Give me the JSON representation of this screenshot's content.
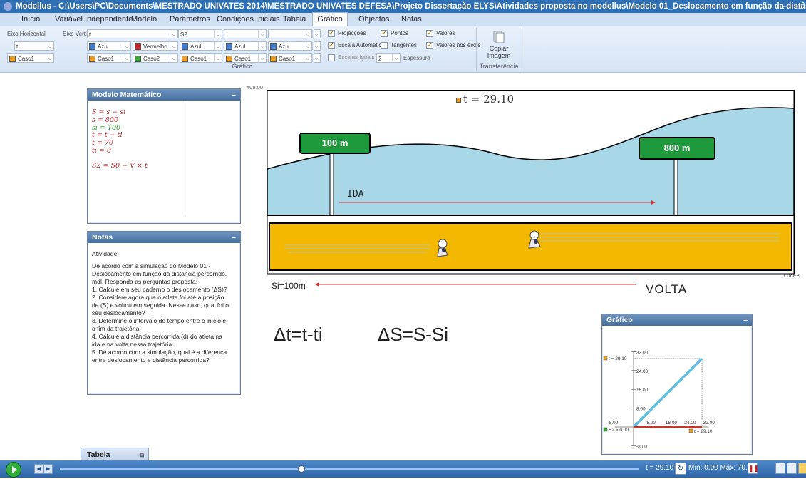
{
  "window": {
    "title": "Modellus - C:\\Users\\PC\\Documents\\MESTRADO UNIVATES 2014\\MESTRADO UNIVATES  DEFESA\\Projeto Dissertação ELYS\\Atividades proposta no modellus\\Modelo 01_Deslocamento em função da distância percorrido.modellus",
    "minimize": "–",
    "maximize": "□"
  },
  "menu": [
    "Início",
    "Variável Independente",
    "Modelo",
    "Parâmetros",
    "Condições Iniciais",
    "Tabela",
    "Gráfico",
    "Objectos",
    "Notas"
  ],
  "ribbon": {
    "eixo_horizontal": "Eixo Horizontal",
    "eixo_vertical": "Eixo Vertical:",
    "eixo_vertical_value": "t",
    "horizontal_value": "t",
    "s2": "S2",
    "colors": {
      "azul": "Azul",
      "vermelho": "Vermelho"
    },
    "caso1": "Caso1",
    "caso2": "Caso2",
    "projeccoes": "Projecções",
    "pontos": "Pontos",
    "valores": "Valores",
    "escala_auto": "Escala Automática",
    "tangentes": "Tangentes",
    "valores_eixos": "Valores nos eixos",
    "escalas_iguais": "Escalas Iguais",
    "espessura_value": "2",
    "espessura": "Espessura",
    "grafico_group": "Gráfico",
    "copiar": "Copiar",
    "imagem": "Imagem",
    "transferencia": "Transferência"
  },
  "modelo": {
    "title": "Modelo Matemático",
    "min": "–",
    "lines": [
      {
        "text": "S = s − si",
        "color": "red"
      },
      {
        "text": "s = 800",
        "color": "red"
      },
      {
        "text": "si = 100",
        "color": "green"
      },
      {
        "text": "t = t − ti",
        "color": "red"
      },
      {
        "text": "t = 70",
        "color": "red"
      },
      {
        "text": "ti = 0",
        "color": "red"
      },
      {
        "text": "",
        "color": "red"
      },
      {
        "text": "S2 = S0 − V × t",
        "color": "red"
      }
    ]
  },
  "notas": {
    "title": "Notas",
    "min": "–",
    "heading": "Atividade",
    "lines": [
      "De acordo com a simulação do Modelo 01 -",
      "Deslocamento em função da distância percorrido.",
      "mdl. Responda as perguntas proposta:",
      "1. Calcule em seu caderno o deslocamento (ΔS)?",
      "2. Considere agora que o atleta foi até a posição",
      "de (S) e voltou em seguida. Nesse caso, qual foi o",
      "seu deslocamento?",
      "3. Determine o intervalo de tempo entre o início e",
      "o fim da trajetória.",
      "4. Calcule a distância percorrida (d) do atleta na",
      "ida e na volta nessa trajetória.",
      "5. De acordo com a simulação, qual é a diferença",
      "entre deslocamento e distância percorrida?"
    ]
  },
  "scene": {
    "y_top_label": "409.00",
    "x_right_label": "1.06E3",
    "t_label": "t = 29.10",
    "sign_100": "100 m",
    "sign_800": "800 m",
    "ida": "IDA",
    "volta": "VOLTA",
    "si_label": "Si=100m",
    "delta_t": "Δt=t-ti",
    "delta_s": "ΔS=S-Si",
    "colors": {
      "water": "#a8d8e8",
      "track": "#f5b800",
      "sign": "#1e9a3c",
      "arrow": "#d03030"
    }
  },
  "grafico": {
    "title": "Gráfico",
    "min": "–",
    "value_label": "t = 29.10",
    "s2_label": "S2 = 0.00",
    "t_end_label": "t = 29.10",
    "y_ticks": [
      "32.00",
      "24.00",
      "16.00",
      "8.00",
      "-8.00"
    ],
    "x_ticks": [
      "8.00",
      "8.00",
      "16.00",
      "24.00",
      "32.00"
    ]
  },
  "chart_data": {
    "type": "line",
    "x": [
      0,
      29.1
    ],
    "series": [
      {
        "name": "t",
        "values": [
          0,
          29.1
        ],
        "color": "#5bbfe6"
      },
      {
        "name": "S2",
        "values": [
          0,
          0
        ],
        "color": "#c8342c"
      }
    ],
    "xlim": [
      -8,
      32
    ],
    "ylim": [
      -8,
      32
    ],
    "grid": false
  },
  "tabela": {
    "label": "Tabela"
  },
  "status": {
    "t_readout": "t = 29.10",
    "min_max": "Mín: 0.00 Máx: 70.00"
  }
}
